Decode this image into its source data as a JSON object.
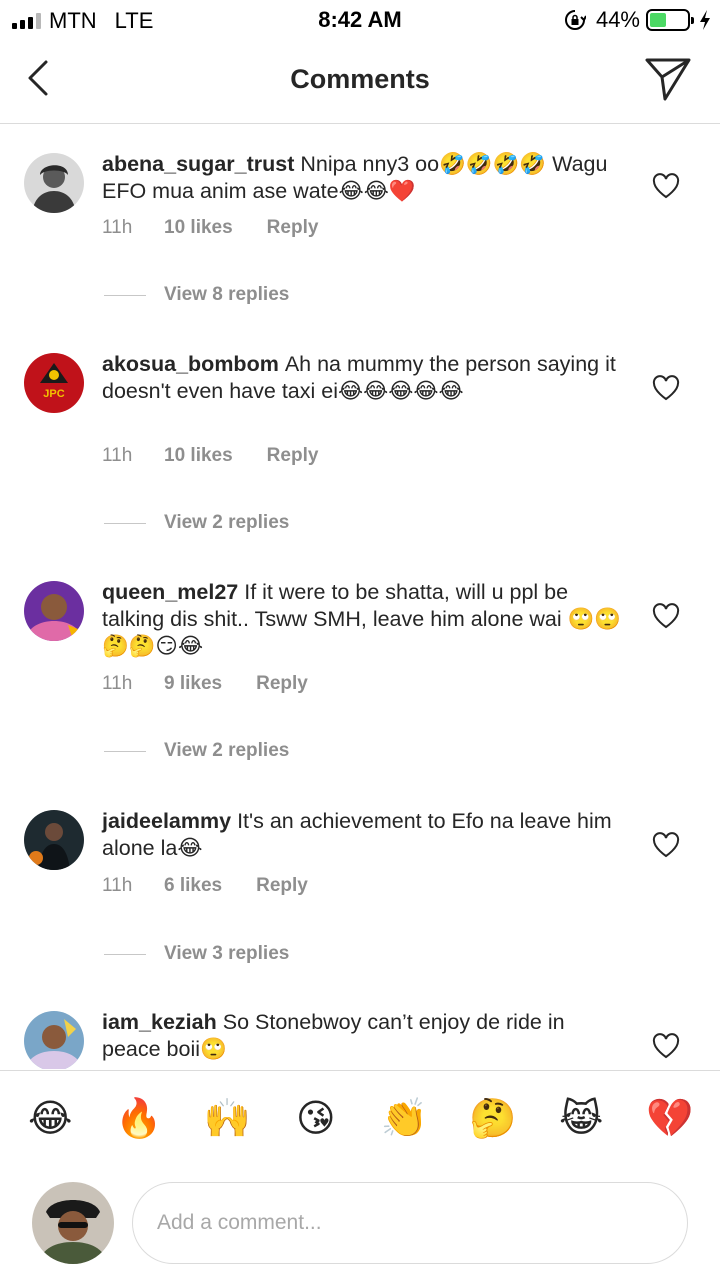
{
  "status_bar": {
    "carrier": "MTN",
    "network": "LTE",
    "time": "8:42 AM",
    "battery": "44%",
    "battery_level": 0.44
  },
  "header": {
    "title": "Comments",
    "back_icon": "chevron-left-icon",
    "share_icon": "paper-plane-icon"
  },
  "comments": [
    {
      "username": "abena_sugar_trust",
      "text": "Nnipa nny3 oo🤣🤣🤣🤣 Wagu EFO mua anim ase wate😂😂❤️",
      "time": "11h",
      "likes": "10 likes",
      "reply": "Reply",
      "view_replies": "View 8 replies"
    },
    {
      "username": "akosua_bombom",
      "text": "Ah na mummy the person saying it doesn't even have taxi ei😂😂😂😂😂",
      "time": "11h",
      "likes": "10 likes",
      "reply": "Reply",
      "view_replies": "View 2 replies",
      "avatar_text": "JPC"
    },
    {
      "username": "queen_mel27",
      "text": "If it were to be shatta, will u ppl be talking dis shit.. Tsww SMH, leave him alone wai 🙄🙄🤔🤔😏😂",
      "time": "11h",
      "likes": "9 likes",
      "reply": "Reply",
      "view_replies": "View 2 replies"
    },
    {
      "username": "jaideelammy",
      "text": "It's an achievement to Efo na leave him alone la😂",
      "time": "11h",
      "likes": "6 likes",
      "reply": "Reply",
      "view_replies": "View 3 replies"
    },
    {
      "username": "iam_keziah",
      "text": "So Stonebwoy can’t enjoy de ride in peace boii🙄"
    }
  ],
  "emoji_bar": [
    "😂",
    "🔥",
    "🙌",
    "😘",
    "👏",
    "🤔",
    "😹",
    "💔"
  ],
  "input": {
    "placeholder": "Add a comment..."
  },
  "colors": {
    "text": "#262626",
    "muted": "#8e8e8e",
    "divider": "#dbdbdb",
    "battery": "#4cd964"
  }
}
